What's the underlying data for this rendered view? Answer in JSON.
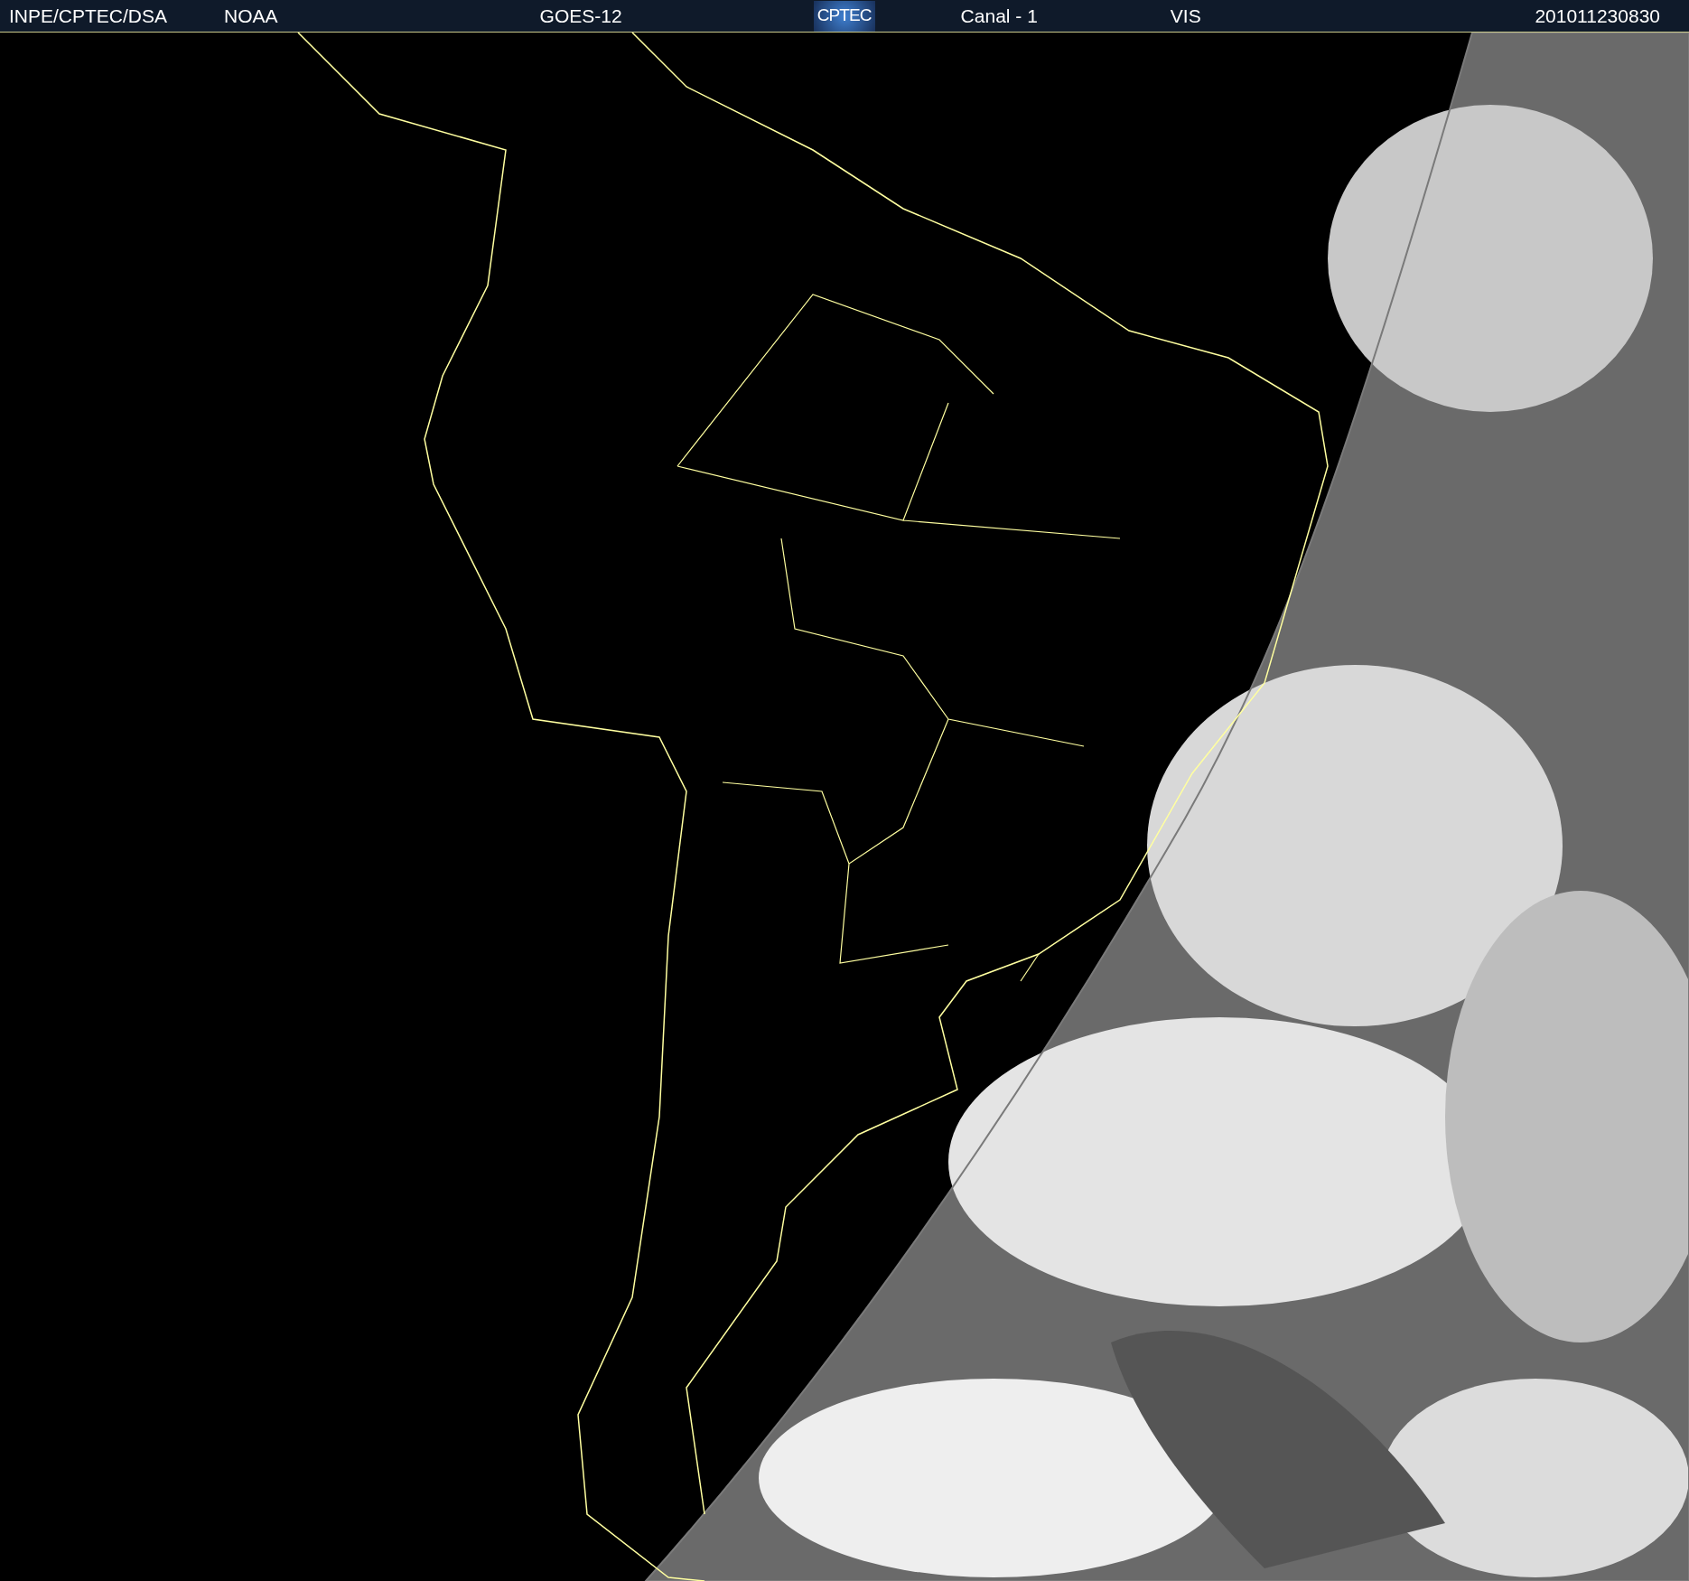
{
  "header": {
    "source": "INPE/CPTEC/DSA",
    "agency": "NOAA",
    "satellite": "GOES-12",
    "logo": "CPTEC",
    "channel": "Canal - 1",
    "band": "VIS",
    "timestamp": "201011230830"
  }
}
